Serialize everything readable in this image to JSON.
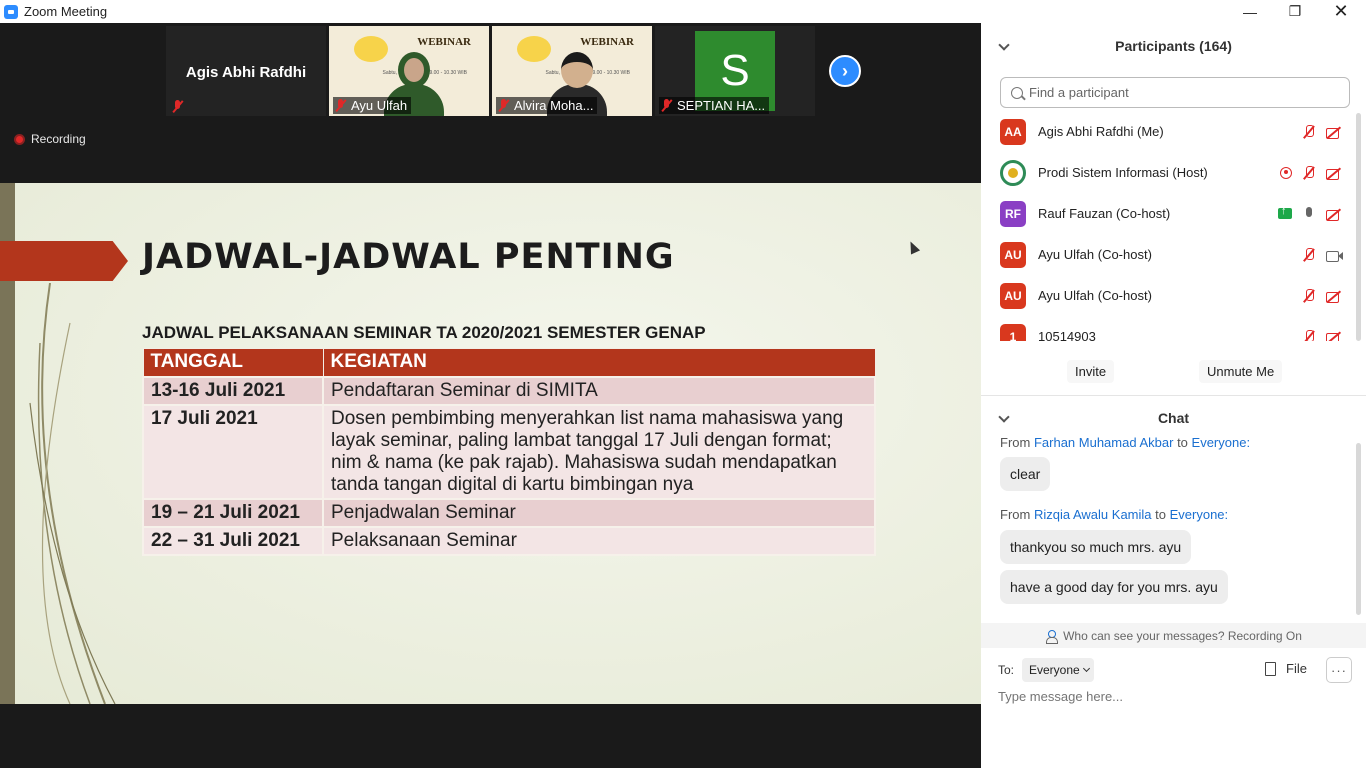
{
  "window": {
    "title": "Zoom Meeting"
  },
  "thumbnails": [
    {
      "name": "Agis Abhi Rafdhi",
      "label": ""
    },
    {
      "label": "Ayu Ulfah",
      "banner": "WEBINAR",
      "sub": "Sabtu, 10 Juli 2021 09.00 - 10.30 WIB"
    },
    {
      "label": "Alvira Moha...",
      "banner": "WEBINAR",
      "sub": "Sabtu, 10 Juli 2021 09.00 - 10.30 WIB"
    },
    {
      "label": "SEPTIAN HA...",
      "initial": "S"
    }
  ],
  "recording": {
    "label": "Recording"
  },
  "slide": {
    "heading": "JADWAL-JADWAL PENTING",
    "subtitle": "JADWAL PELAKSANAAN SEMINAR TA 2020/2021 SEMESTER GENAP",
    "table": {
      "headers": [
        "TANGGAL",
        "KEGIATAN"
      ],
      "rows": [
        [
          "13-16 Juli 2021",
          "Pendaftaran Seminar di SIMITA"
        ],
        [
          "17 Juli 2021",
          "Dosen pembimbing menyerahkan list nama mahasiswa yang layak seminar, paling lambat tanggal 17 Juli dengan format; nim & nama (ke pak rajab). Mahasiswa sudah mendapatkan tanda tangan digital di kartu bimbingan nya"
        ],
        [
          "19 – 21 Juli 2021",
          "Penjadwalan Seminar"
        ],
        [
          "22 – 31 Juli 2021",
          "Pelaksanaan Seminar"
        ]
      ]
    }
  },
  "participants": {
    "title": "Participants (164)",
    "search_placeholder": "Find a participant",
    "list": [
      {
        "initials": "AA",
        "name": "Agis Abhi Rafdhi (Me)",
        "color": "#d9381e"
      },
      {
        "initials": "",
        "name": "Prodi Sistem Informasi (Host)",
        "color": "#2e8b57"
      },
      {
        "initials": "RF",
        "name": "Rauf Fauzan (Co-host)",
        "color": "#8a3fc4"
      },
      {
        "initials": "AU",
        "name": "Ayu Ulfah (Co-host)",
        "color": "#d9381e"
      },
      {
        "initials": "AU",
        "name": "Ayu Ulfah (Co-host)",
        "color": "#d9381e"
      },
      {
        "initials": "1",
        "name": "10514903",
        "color": "#d9381e"
      }
    ],
    "invite_label": "Invite",
    "unmute_label": "Unmute Me"
  },
  "chat": {
    "title": "Chat",
    "messages": [
      {
        "from_prefix": "From",
        "sender": "Farhan Muhamad Akbar",
        "to_word": "to",
        "recipient": "Everyone:",
        "texts": [
          "clear"
        ]
      },
      {
        "from_prefix": "From",
        "sender": "Rizqia Awalu Kamila",
        "to_word": "to",
        "recipient": "Everyone:",
        "texts": [
          "thankyou so much mrs. ayu",
          "have a good day for you mrs. ayu"
        ]
      }
    ],
    "visibility_note": "Who can see your messages? Recording On",
    "to_label": "To:",
    "to_value": "Everyone",
    "file_label": "File",
    "more_label": "···",
    "input_placeholder": "Type message here..."
  }
}
